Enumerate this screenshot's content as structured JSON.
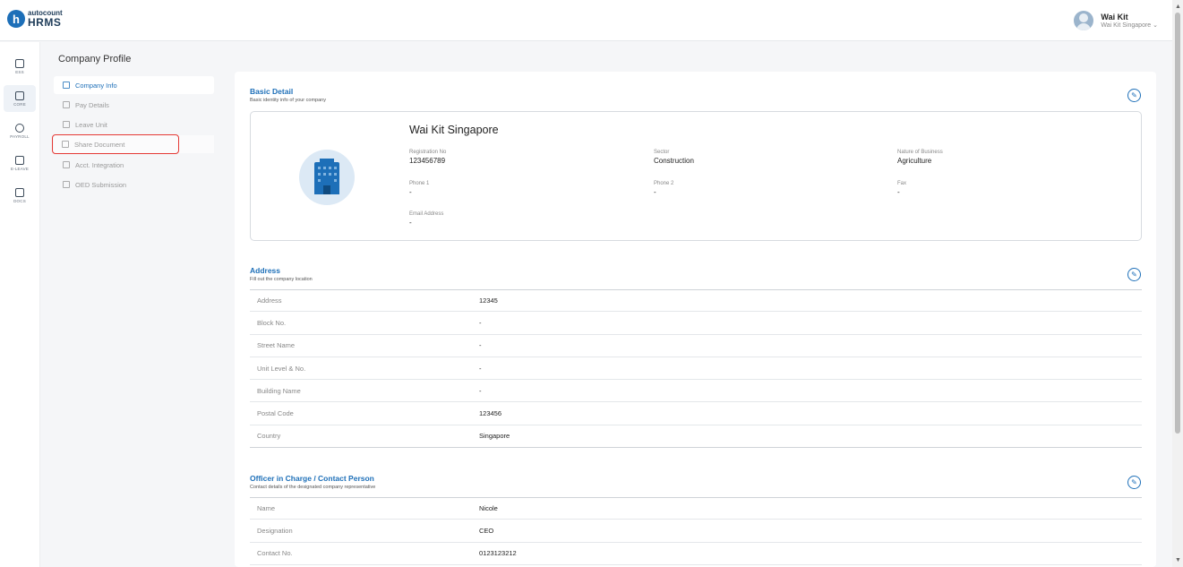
{
  "app": {
    "brand": "autocount",
    "product": "HRMS",
    "logo_letter": "h"
  },
  "user": {
    "name": "Wai Kit",
    "company": "Wai Kit Singapore ⌄"
  },
  "rail": [
    {
      "label": "ESS",
      "icon": "ess-icon"
    },
    {
      "label": "CORE",
      "icon": "core-icon",
      "active": true
    },
    {
      "label": "PAYROLL",
      "icon": "payroll-icon"
    },
    {
      "label": "E-LEAVE",
      "icon": "eleave-icon"
    },
    {
      "label": "DOCS",
      "icon": "docs-icon"
    }
  ],
  "submenu": {
    "title": "Company Profile",
    "items": [
      {
        "label": "Company Info"
      },
      {
        "label": "Pay Details"
      },
      {
        "label": "Leave Unit"
      },
      {
        "label": "Share Document"
      },
      {
        "label": "Acct. Integration"
      },
      {
        "label": "OED Submission"
      }
    ]
  },
  "basic": {
    "title": "Basic Detail",
    "subtitle": "Basic identity info of your company",
    "company_name": "Wai Kit Singapore",
    "fields": {
      "reg_label": "Registration No",
      "reg_value": "123456789",
      "sector_label": "Sector",
      "sector_value": "Construction",
      "nature_label": "Nature of Business",
      "nature_value": "Agriculture",
      "phone1_label": "Phone 1",
      "phone1_value": "-",
      "phone2_label": "Phone 2",
      "phone2_value": "-",
      "fax_label": "Fax",
      "fax_value": "-",
      "email_label": "Email Address",
      "email_value": "-"
    }
  },
  "address": {
    "title": "Address",
    "subtitle": "Fill out the company location",
    "rows": [
      {
        "k": "Address",
        "v": "12345"
      },
      {
        "k": "Block No.",
        "v": "-"
      },
      {
        "k": "Street Name",
        "v": "-"
      },
      {
        "k": "Unit Level & No.",
        "v": "-"
      },
      {
        "k": "Building Name",
        "v": "-"
      },
      {
        "k": "Postal Code",
        "v": "123456"
      },
      {
        "k": "Country",
        "v": "Singapore"
      }
    ]
  },
  "officer": {
    "title": "Officer in Charge / Contact Person",
    "subtitle": "Contact details of the designated company representative",
    "rows": [
      {
        "k": "Name",
        "v": "Nicole"
      },
      {
        "k": "Designation",
        "v": "CEO"
      },
      {
        "k": "Contact No.",
        "v": "0123123212"
      }
    ]
  },
  "icons": {
    "edit": "✎"
  }
}
